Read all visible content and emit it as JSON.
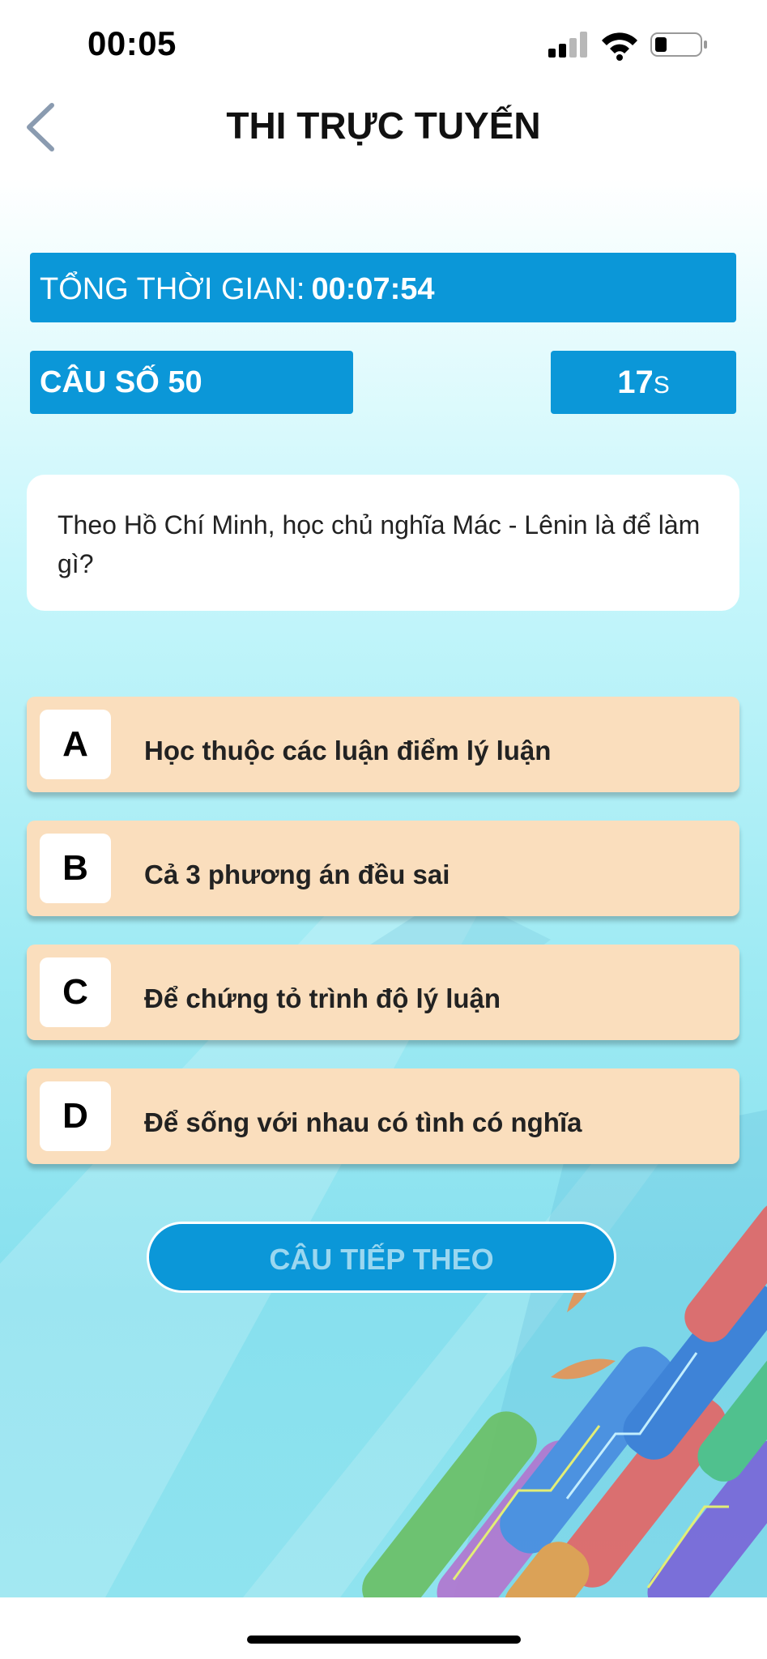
{
  "status_bar": {
    "time": "00:05"
  },
  "header": {
    "title": "THI TRỰC TUYẾN"
  },
  "timer": {
    "total_label": "TỔNG THỜI GIAN:",
    "total_value": "00:07:54"
  },
  "question_number": "CÂU SỐ 50",
  "countdown": {
    "value": "17",
    "unit": "S"
  },
  "question": {
    "text": "Theo Hồ Chí Minh, học chủ nghĩa Mác - Lênin là để làm gì?"
  },
  "answers": [
    {
      "letter": "A",
      "text": "Học thuộc các luận điểm lý luận"
    },
    {
      "letter": "B",
      "text": "Cả 3 phương án đều sai"
    },
    {
      "letter": "C",
      "text": "Để chứng tỏ trình độ lý luận"
    },
    {
      "letter": "D",
      "text": "Để sống với nhau có tình có nghĩa"
    }
  ],
  "next_button": {
    "label": "CÂU TIẾP THEO"
  },
  "colors": {
    "primary": "#0b97d8",
    "answer_bg": "#fadebd",
    "next_label": "#9ad7f0"
  }
}
